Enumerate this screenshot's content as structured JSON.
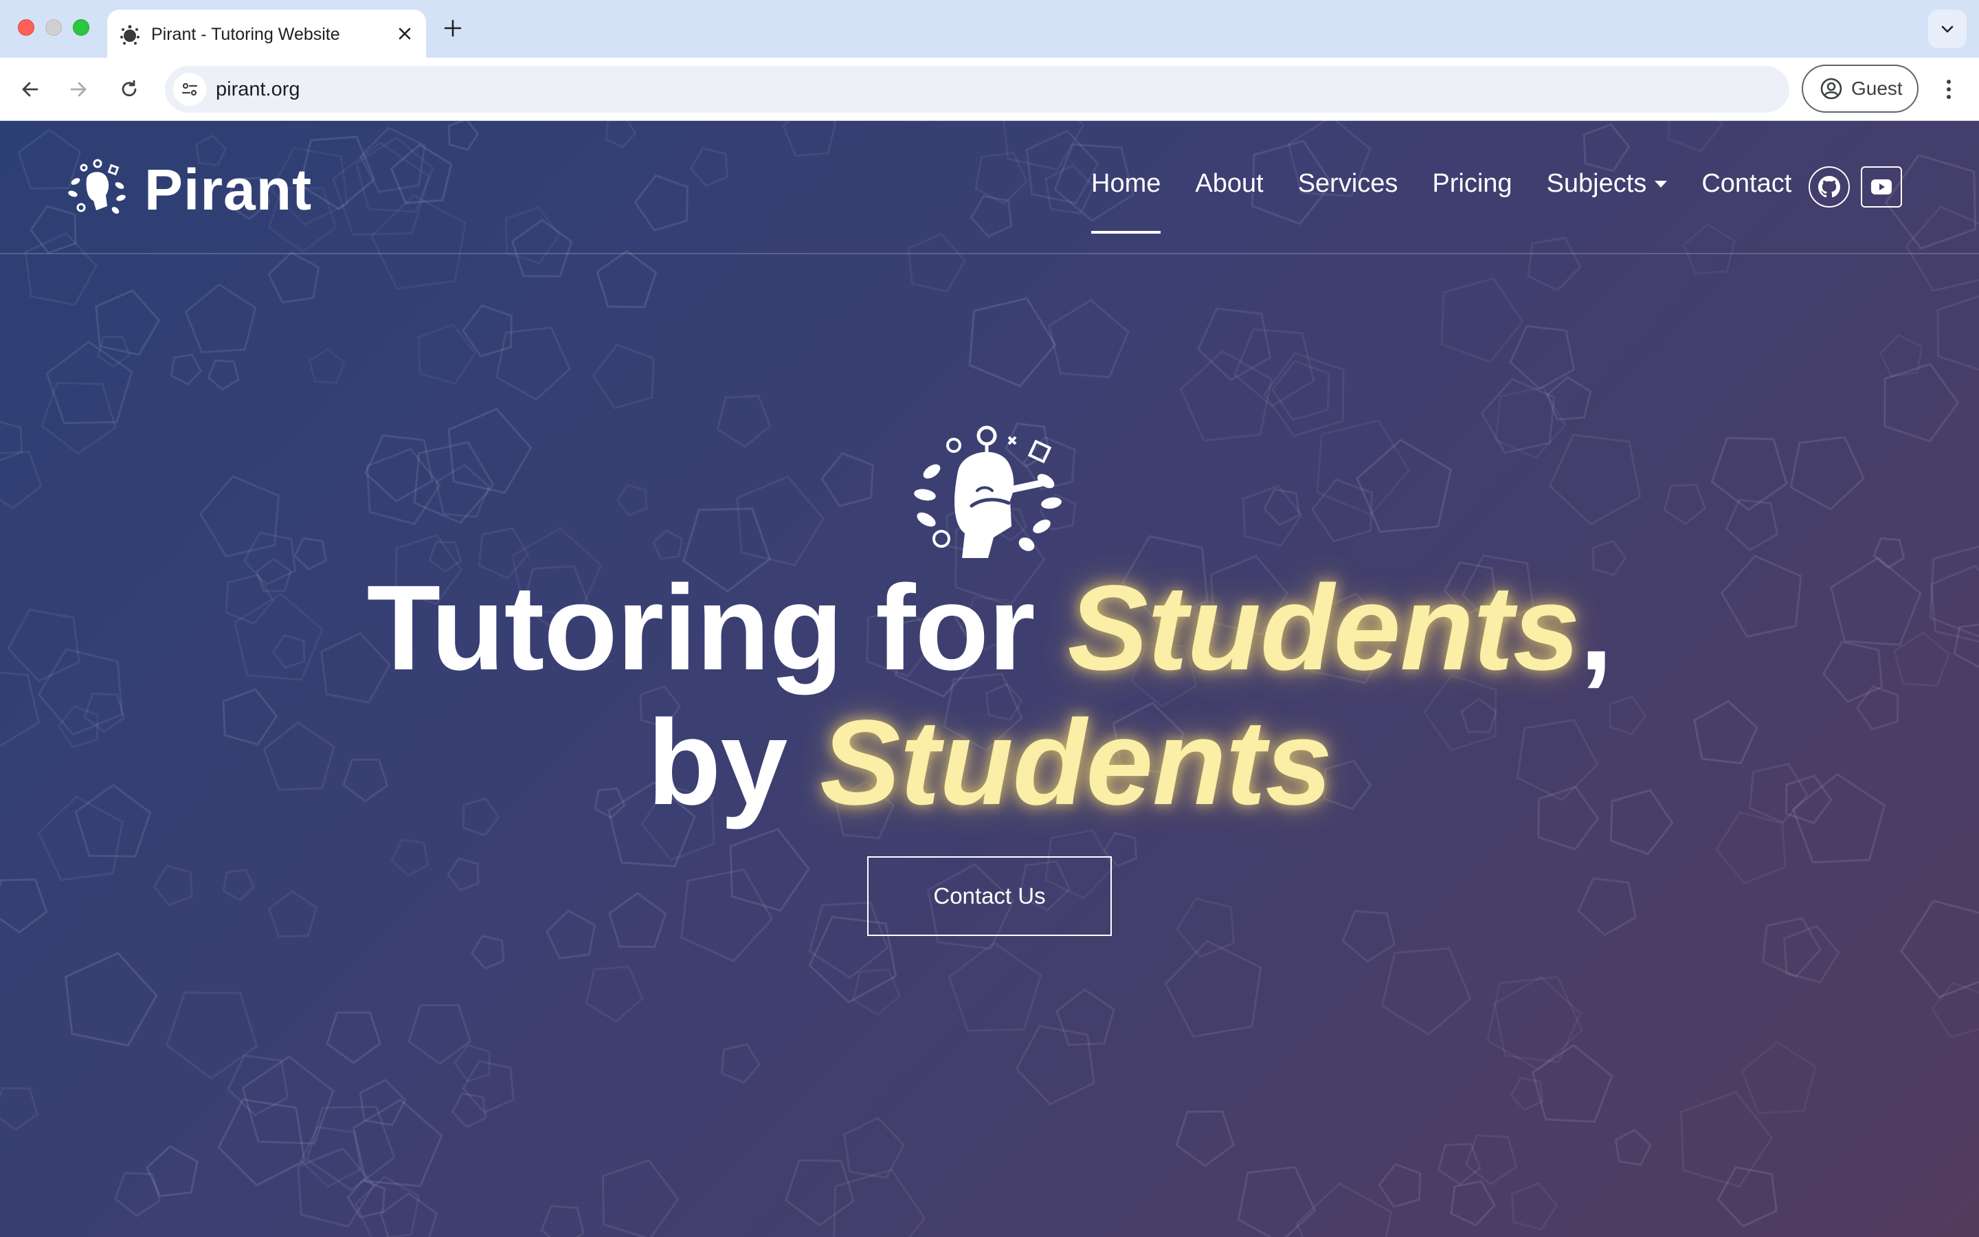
{
  "browser": {
    "tab_title": "Pirant - Tutoring Website",
    "url": "pirant.org",
    "profile_label": "Guest",
    "icons": [
      "close-icon",
      "plus-icon",
      "chevron-down-icon",
      "back-arrow-icon",
      "forward-arrow-icon",
      "reload-icon",
      "site-info-icon",
      "user-circle-icon",
      "kebab-menu-icon"
    ]
  },
  "site": {
    "brand": "Pirant",
    "nav": [
      {
        "label": "Home",
        "active": true
      },
      {
        "label": "About"
      },
      {
        "label": "Services"
      },
      {
        "label": "Pricing"
      },
      {
        "label": "Subjects",
        "has_dropdown": true
      },
      {
        "label": "Contact"
      }
    ],
    "social_icons": [
      "github-icon",
      "youtube-icon"
    ]
  },
  "hero": {
    "line1_prefix": "Tutoring for ",
    "line1_highlight": "Students",
    "line1_suffix": ",",
    "line2_prefix": "by ",
    "line2_highlight": "Students",
    "cta_label": "Contact Us"
  },
  "colors": {
    "highlight_text": "#fbeea6",
    "tabstrip": "#d4e2f8",
    "gradient_start": "#2c3f74",
    "gradient_end": "#523c5e"
  }
}
